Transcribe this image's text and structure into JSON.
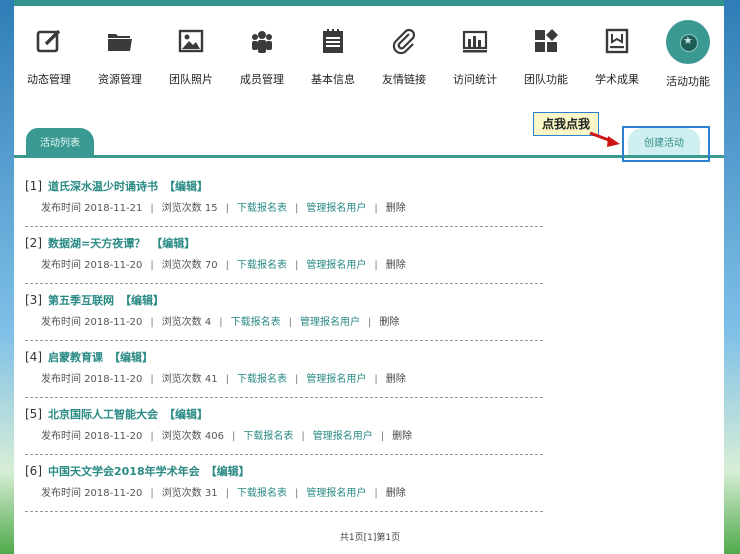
{
  "nav": [
    {
      "label": "动态管理",
      "icon": "edit-icon"
    },
    {
      "label": "资源管理",
      "icon": "folder-icon"
    },
    {
      "label": "团队照片",
      "icon": "image-icon"
    },
    {
      "label": "成员管理",
      "icon": "people-icon"
    },
    {
      "label": "基本信息",
      "icon": "notepad-icon"
    },
    {
      "label": "友情链接",
      "icon": "paperclip-icon"
    },
    {
      "label": "访问统计",
      "icon": "bar-chart-icon"
    },
    {
      "label": "团队功能",
      "icon": "grid-icon"
    },
    {
      "label": "学术成果",
      "icon": "portrait-icon"
    },
    {
      "label": "活动功能",
      "icon": "badge-icon",
      "active": true
    }
  ],
  "tabs": {
    "list": "活动列表",
    "create": "创建活动"
  },
  "callout": "点我点我",
  "meta_labels": {
    "publish": "发布时间",
    "views": "浏览次数",
    "download": "下载报名表",
    "manage": "管理报名用户",
    "delete": "删除",
    "edit": "【编辑】"
  },
  "items": [
    {
      "num": "[1]",
      "title": "道氏深水温少时诵诗书",
      "date": "2018-11-21",
      "views": "15"
    },
    {
      "num": "[2]",
      "title": "数据湖=天方夜谭？",
      "date": "2018-11-20",
      "views": "70"
    },
    {
      "num": "[3]",
      "title": "第五季互联网",
      "date": "2018-11-20",
      "views": "4"
    },
    {
      "num": "[4]",
      "title": "启蒙教育课",
      "date": "2018-11-20",
      "views": "41"
    },
    {
      "num": "[5]",
      "title": "北京国际人工智能大会",
      "date": "2018-11-20",
      "views": "406"
    },
    {
      "num": "[6]",
      "title": "中国天文学会2018年学术年会",
      "date": "2018-11-20",
      "views": "31"
    }
  ],
  "pager": "共1页[1]第1页",
  "colors": {
    "accent": "#3a9a91",
    "link": "#2a8a84",
    "highlight": "#2d7fd0",
    "callout_bg": "#fbf7c6"
  }
}
